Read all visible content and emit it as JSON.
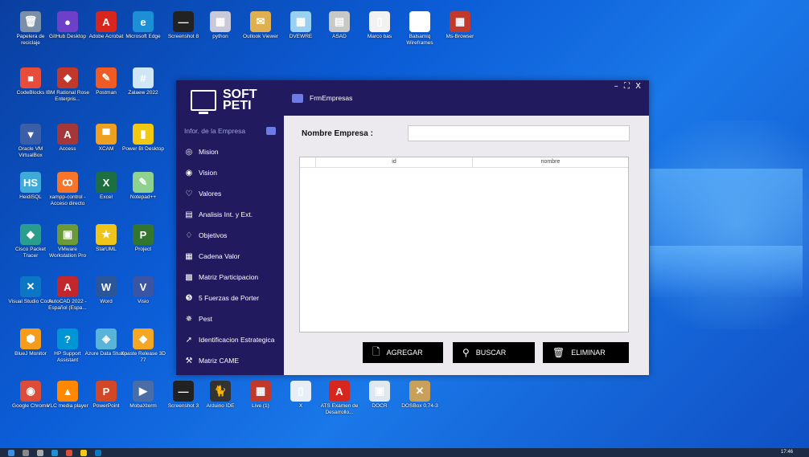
{
  "desktop_icons": [
    {
      "label": "Papelera de reciclaje",
      "color": "#7b8fa8",
      "glyph": "🗑"
    },
    {
      "label": "GitHub Desktop",
      "color": "#6e40c9",
      "glyph": "●"
    },
    {
      "label": "Adobe Acrobat",
      "color": "#d7261e",
      "glyph": "A"
    },
    {
      "label": "Microsoft Edge",
      "color": "#1c8fd6",
      "glyph": "e"
    },
    {
      "label": "Screenshot 8",
      "color": "#222222",
      "glyph": "—"
    },
    {
      "label": "python",
      "color": "#c9c9d9",
      "glyph": "▦"
    },
    {
      "label": "Outlook Viewer",
      "color": "#e0b050",
      "glyph": "✉"
    },
    {
      "label": "DVEWRE",
      "color": "#9ad0f2",
      "glyph": "▦"
    },
    {
      "label": "ASAD",
      "color": "#c8c8c8",
      "glyph": "▤"
    },
    {
      "label": "Marco bas",
      "color": "#f2f2f2",
      "glyph": "▯"
    },
    {
      "label": "Balsamiq Wireframes",
      "color": "#ffffff",
      "glyph": "☺"
    },
    {
      "label": "Ms-Browser",
      "color": "#c0392b",
      "glyph": "▦"
    },
    {
      "label": "CodeBlocks",
      "color": "#e74c3c",
      "glyph": "■"
    },
    {
      "label": "IBM Rational Rose Enterpris...",
      "color": "#c0392b",
      "glyph": "◆"
    },
    {
      "label": "Postman",
      "color": "#ef5b25",
      "glyph": "✎"
    },
    {
      "label": "Zalaew 2022",
      "color": "#cfe6f5",
      "glyph": "#"
    },
    {
      "label": "Oracle VM VirtualBox",
      "color": "#3b5ea8",
      "glyph": "▼"
    },
    {
      "label": "Access",
      "color": "#a4373a",
      "glyph": "A"
    },
    {
      "label": "XCAM",
      "color": "#f0a020",
      "glyph": "▀"
    },
    {
      "label": "Power BI Desktop",
      "color": "#f2c811",
      "glyph": "▮"
    },
    {
      "label": "HeidiSQL",
      "color": "#3fa9d8",
      "glyph": "HS"
    },
    {
      "label": "xampp-control - Acceso directo",
      "color": "#f7742b",
      "glyph": "ꝏ"
    },
    {
      "label": "Excel",
      "color": "#1d6f42",
      "glyph": "X"
    },
    {
      "label": "Notepad++",
      "color": "#8fd18f",
      "glyph": "✎"
    },
    {
      "label": "Cisco Packet Tracer",
      "color": "#2a9d8f",
      "glyph": "◆"
    },
    {
      "label": "VMware Workstation Pro",
      "color": "#6c9a3b",
      "glyph": "▣"
    },
    {
      "label": "StarUML",
      "color": "#f0c419",
      "glyph": "★"
    },
    {
      "label": "Project",
      "color": "#31752f",
      "glyph": "P"
    },
    {
      "label": "Visual Studio Code",
      "color": "#0a76c4",
      "glyph": "✕"
    },
    {
      "label": "AutoCAD 2022 - Español (Espa...",
      "color": "#c1272d",
      "glyph": "A"
    },
    {
      "label": "Word",
      "color": "#2b579a",
      "glyph": "W"
    },
    {
      "label": "Visio",
      "color": "#3955a3",
      "glyph": "V"
    },
    {
      "label": "BlueJ Monitor",
      "color": "#f59c1a",
      "glyph": "⬢"
    },
    {
      "label": "HP Support Assistant",
      "color": "#0096d6",
      "glyph": "?"
    },
    {
      "label": "Azure Data Studio",
      "color": "#59b4d9",
      "glyph": "◈"
    },
    {
      "label": "Xpaste Release 3D 77",
      "color": "#f5a623",
      "glyph": "◆"
    },
    {
      "label": "Google Chrome",
      "color": "#dd4b39",
      "glyph": "◉"
    },
    {
      "label": "VLC media player",
      "color": "#ff8800",
      "glyph": "▲"
    },
    {
      "label": "PowerPoint",
      "color": "#d24726",
      "glyph": "P"
    },
    {
      "label": "MobaXterm",
      "color": "#4a6da7",
      "glyph": "▶"
    },
    {
      "label": "Screenshot 3",
      "color": "#222222",
      "glyph": "—"
    },
    {
      "label": "Arduino IDE",
      "color": "#333333",
      "glyph": "🐈"
    },
    {
      "label": "Live (1)",
      "color": "#c0392b",
      "glyph": "▦"
    },
    {
      "label": "X",
      "color": "#e8eef5",
      "glyph": "▯"
    },
    {
      "label": "ATS Examen de Desarrollo...",
      "color": "#d7261e",
      "glyph": "A"
    },
    {
      "label": "DOCR",
      "color": "#dfe8f0",
      "glyph": "▣"
    },
    {
      "label": "DOSBox 0.74-3",
      "color": "#c9a05a",
      "glyph": "✕"
    }
  ],
  "app": {
    "logo_line1": "SOFT",
    "logo_line2": "PETI",
    "window_title": "FrmEmpresas",
    "window_controls": "– ⛶ X",
    "nav": [
      {
        "label": "Infor. de la Empresa",
        "icon": "folder-icon"
      },
      {
        "label": "Mision",
        "icon": "target-icon",
        "glyph": "◎"
      },
      {
        "label": "Vision",
        "icon": "eye-icon",
        "glyph": "◉"
      },
      {
        "label": "Valores",
        "icon": "heart-icon",
        "glyph": "♡"
      },
      {
        "label": "Analisis Int. y Ext.",
        "icon": "list-icon",
        "glyph": "▤"
      },
      {
        "label": "Objetivos",
        "icon": "bell-icon",
        "glyph": "♢"
      },
      {
        "label": "Cadena Valor",
        "icon": "chart-icon",
        "glyph": "▦"
      },
      {
        "label": "Matriz Participacion",
        "icon": "grid-icon",
        "glyph": "▩"
      },
      {
        "label": "5 Fuerzas de Porter",
        "icon": "five-icon",
        "glyph": "❺"
      },
      {
        "label": "Pest",
        "icon": "bug-icon",
        "glyph": "✵"
      },
      {
        "label": "Identificacion Estrategica",
        "icon": "cursor-icon",
        "glyph": "➚"
      },
      {
        "label": "Matriz CAME",
        "icon": "tools-icon",
        "glyph": "⚒"
      }
    ],
    "form": {
      "company_label": "Nombre Empresa :",
      "company_value": ""
    },
    "grid_columns": [
      "id",
      "nombre"
    ],
    "buttons": {
      "add": "AGREGAR",
      "search": "BUSCAR",
      "delete": "ELIMINAR"
    }
  },
  "taskbar": {
    "time": "17:46"
  }
}
